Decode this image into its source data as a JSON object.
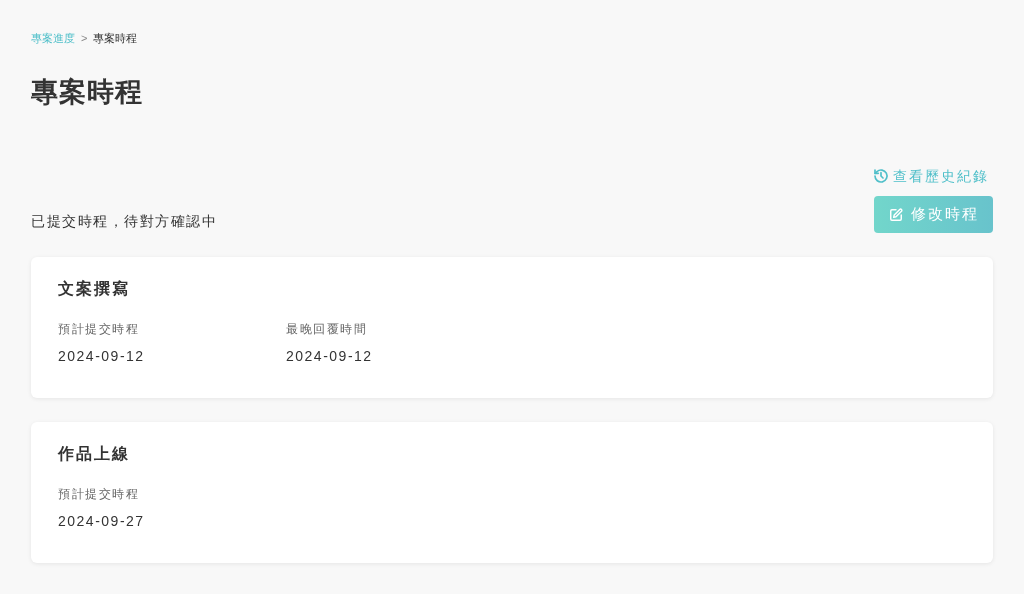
{
  "breadcrumb": [
    {
      "label": "專案進度",
      "kind": "link"
    },
    {
      "label": ">",
      "kind": "separator"
    },
    {
      "label": "專案時程",
      "kind": "current"
    }
  ],
  "title": "專案時程",
  "history_link": "查看歷史紀錄",
  "status_text": "已提交時程，待對方確認中",
  "edit_button": "修改時程",
  "cards": [
    {
      "title": "文案撰寫",
      "fields": [
        {
          "label": "預計提交時程",
          "value": "2024-09-12"
        },
        {
          "label": "最晚回覆時間",
          "value": "2024-09-12"
        }
      ]
    },
    {
      "title": "作品上線",
      "fields": [
        {
          "label": "預計提交時程",
          "value": "2024-09-27"
        }
      ]
    }
  ]
}
